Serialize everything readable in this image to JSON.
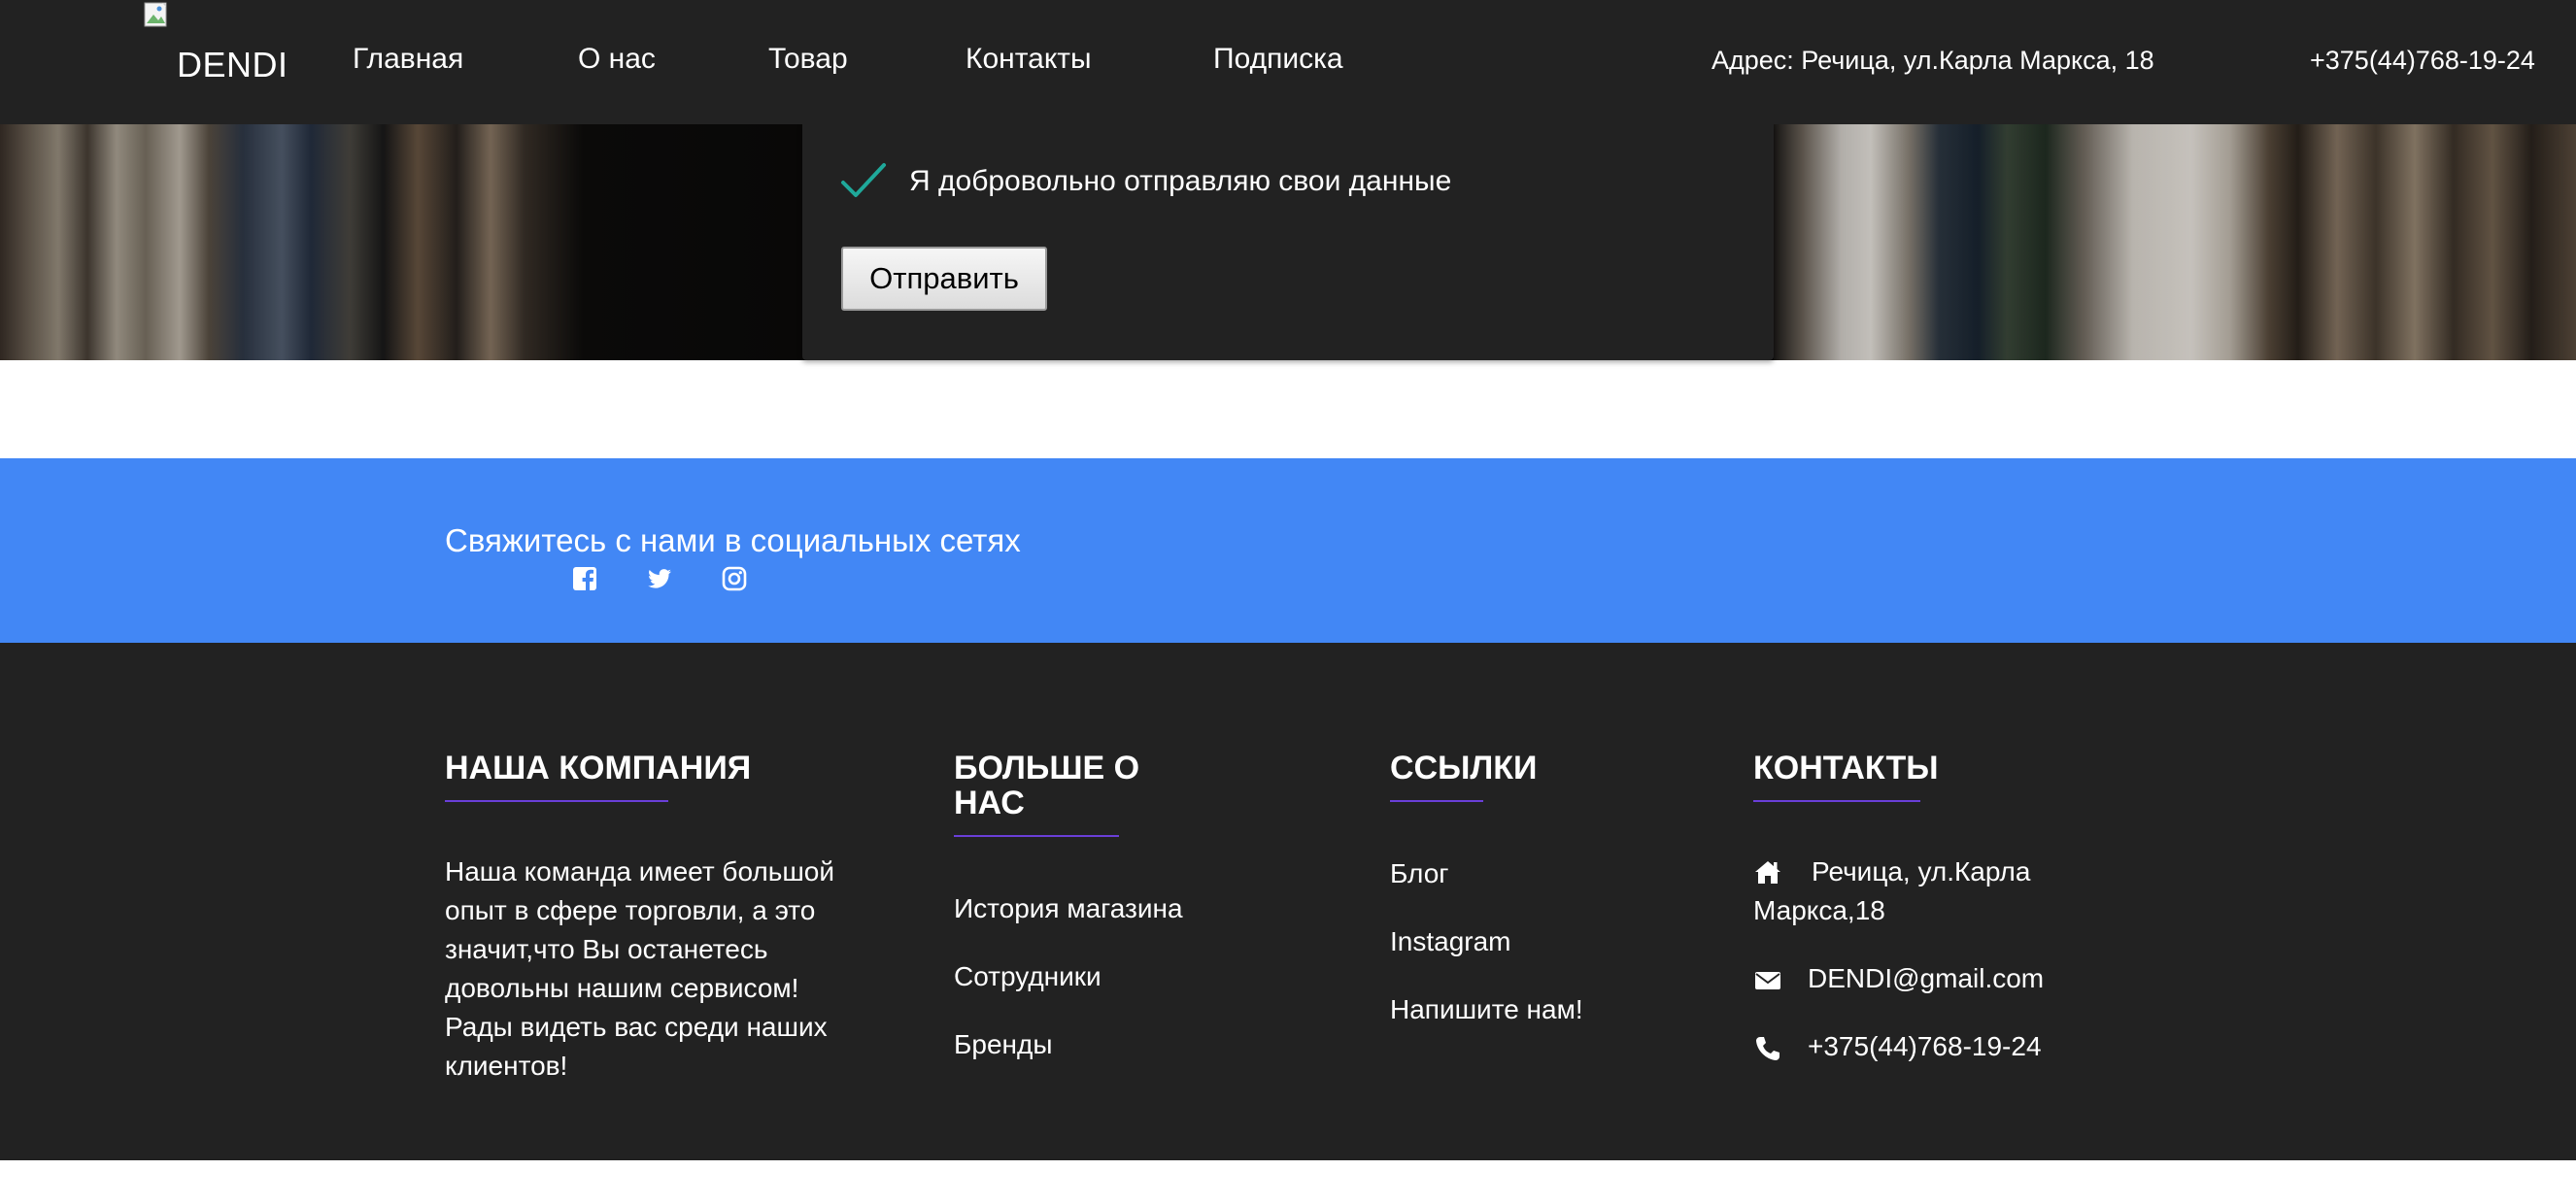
{
  "header": {
    "logo_text": "DENDI",
    "nav": [
      "Главная",
      "О нас",
      "Товар",
      "Контакты",
      "Подписка"
    ],
    "address": "Адрес: Речица, ул.Карла Маркса, 18",
    "phone": "+375(44)768-19-24"
  },
  "form": {
    "consent": "Я добровольно отправляю свои данные",
    "consent_checked": true,
    "submit_label": "Отправить"
  },
  "social": {
    "title": "Свяжитесь с нами в социальных сетях",
    "icons": [
      "facebook-icon",
      "twitter-icon",
      "instagram-icon"
    ]
  },
  "footer": {
    "company": {
      "heading": "НАША КОМПАНИЯ",
      "text": "Наша команда имеет большой опыт в сфере торговли, а это значит,что Вы останетесь довольны нашим сервисом! Рады видеть вас среди наших клиентов!"
    },
    "about": {
      "heading": "БОЛЬШЕ О НАС",
      "links": [
        "История магазина",
        "Сотрудники",
        "Бренды"
      ]
    },
    "links": {
      "heading": "ССЫЛКИ",
      "items": [
        "Блог",
        "Instagram",
        "Напишите нам!"
      ]
    },
    "contacts": {
      "heading": "КОНТАКТЫ",
      "address": "Речица, ул.Карла Маркса,18",
      "email": "DENDI@gmail.com",
      "phone": "+375(44)768-19-24"
    }
  },
  "colors": {
    "header_bg": "#222222",
    "social_bg": "#4287f5",
    "accent_line": "#6a3fd8",
    "check": "#1fa89a"
  }
}
